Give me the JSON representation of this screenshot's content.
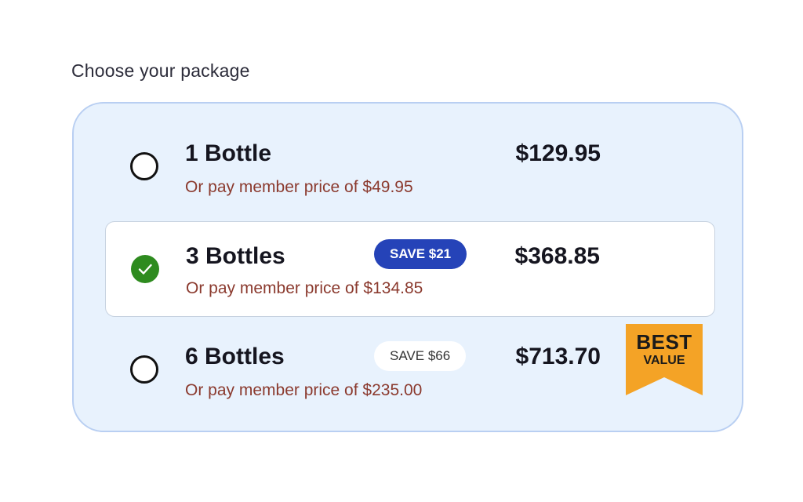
{
  "heading": "Choose your package",
  "options": [
    {
      "title": "1 Bottle",
      "member_text": "Or pay member price of $49.95",
      "price": "$129.95",
      "badge": "",
      "selected": false
    },
    {
      "title": "3 Bottles",
      "member_text": "Or pay member price of $134.85",
      "price": "$368.85",
      "badge": "SAVE $21",
      "selected": true
    },
    {
      "title": "6 Bottles",
      "member_text": "Or pay member price of $235.00",
      "price": "$713.70",
      "badge": "SAVE $66",
      "selected": false
    }
  ],
  "ribbon": {
    "line1": "BEST",
    "line2": "VALUE"
  },
  "colors": {
    "panel_bg": "#e8f2fd",
    "panel_border": "#b9cff2",
    "selected_check": "#2e8b1f",
    "save_badge_blue": "#2543b8",
    "member_text": "#8b3a2e",
    "ribbon": "#f4a326"
  },
  "icons": {
    "selected": "check-icon",
    "unselected": "radio-empty-icon"
  }
}
